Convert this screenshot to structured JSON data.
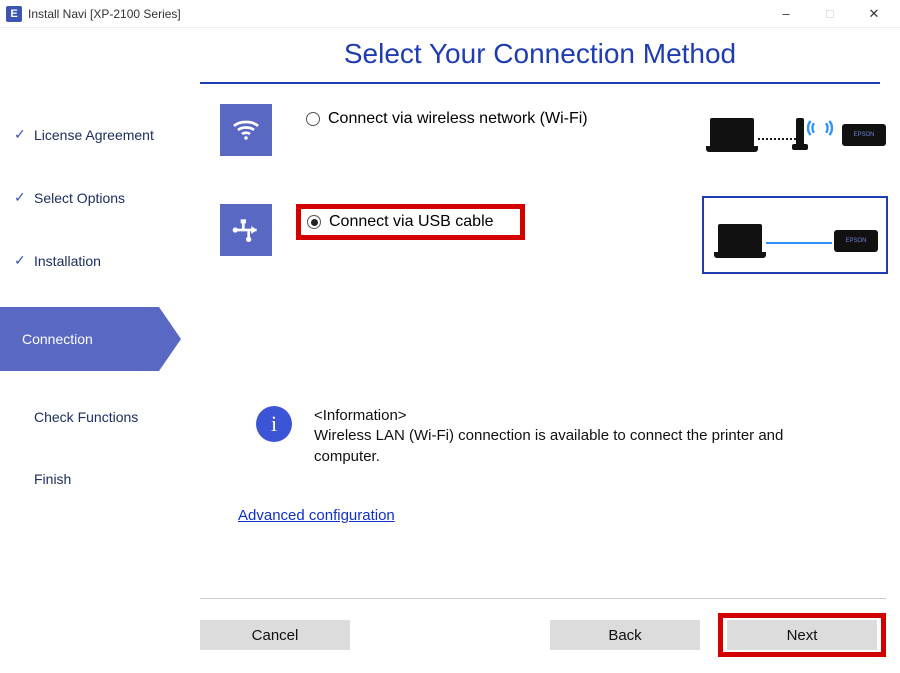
{
  "window": {
    "app_icon_letter": "E",
    "title": "Install Navi [XP-2100 Series]"
  },
  "heading": "Select Your Connection Method",
  "steps": [
    {
      "label": "License Agreement",
      "state": "done"
    },
    {
      "label": "Select Options",
      "state": "done"
    },
    {
      "label": "Installation",
      "state": "done"
    },
    {
      "label": "Connection",
      "state": "current"
    },
    {
      "label": "Check Functions",
      "state": "future"
    },
    {
      "label": "Finish",
      "state": "future"
    }
  ],
  "options": {
    "wifi": {
      "label": "Connect via wireless network (Wi-Fi)",
      "selected": false
    },
    "usb": {
      "label": "Connect via USB cable",
      "selected": true,
      "highlighted": true
    }
  },
  "info": {
    "heading": "<Information>",
    "body": "Wireless LAN (Wi-Fi) connection is available to connect the printer and computer."
  },
  "advanced_link": "Advanced configuration",
  "buttons": {
    "cancel": "Cancel",
    "back": "Back",
    "next": "Next",
    "next_highlighted": true
  }
}
